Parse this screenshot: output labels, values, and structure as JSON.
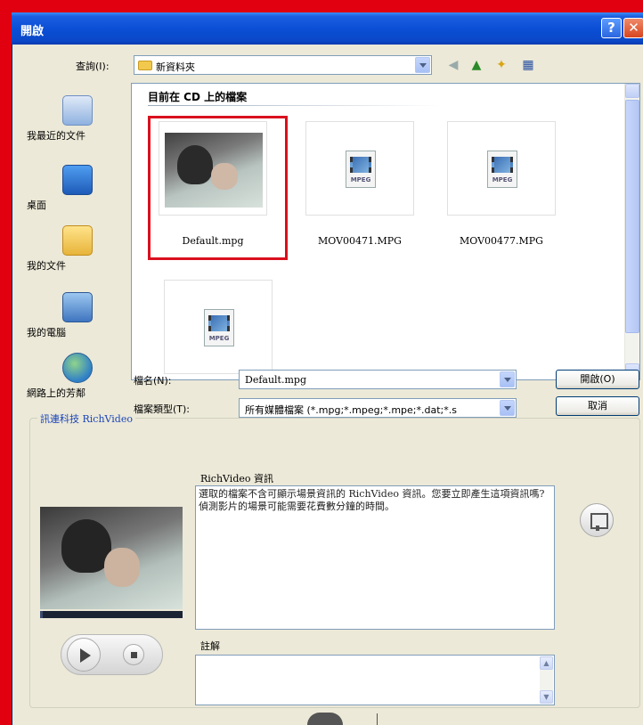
{
  "window": {
    "title": "開啟"
  },
  "lookin": {
    "label": "查詢(I):",
    "value": "新資料夾"
  },
  "toolbar": {
    "back": "◀",
    "up": "▲",
    "new_folder": "✦",
    "views": "▦"
  },
  "places": [
    {
      "label": "我最近的文件"
    },
    {
      "label": "桌面"
    },
    {
      "label": "我的文件"
    },
    {
      "label": "我的電腦"
    },
    {
      "label": "網路上的芳鄰"
    }
  ],
  "filelist": {
    "section_header": "目前在 CD 上的檔案",
    "files": [
      {
        "name": "Default.mpg",
        "kind": "video-thumbnail"
      },
      {
        "name": "MOV00471.MPG",
        "kind": "mpeg-icon"
      },
      {
        "name": "MOV00477.MPG",
        "kind": "mpeg-icon"
      },
      {
        "name": "",
        "kind": "mpeg-icon"
      }
    ],
    "mpeg_tag": "MPEG"
  },
  "filename": {
    "label": "檔名(N):",
    "value": "Default.mpg"
  },
  "filetype": {
    "label": "檔案類型(T):",
    "value": "所有媒體檔案 (*.mpg;*.mpeg;*.mpe;*.dat;*.s"
  },
  "buttons": {
    "open": "開啟(O)",
    "cancel": "取消"
  },
  "richvideo": {
    "group_title": "訊連科技 RichVideo",
    "info_label": "RichVideo 資訊",
    "info_text": "選取的檔案不含可顯示場景資訊的 RichVideo 資訊。您要立即產生這項資訊嗎?偵測影片的場景可能需要花費數分鐘的時間。",
    "notes_label": "註解",
    "notes_text": "",
    "progress": 0.02
  },
  "colors": {
    "frame_red": "#e00010",
    "titlebar_blue": "#0b4fd6",
    "dialog_bg": "#ece9d8",
    "highlight_red": "#d9101e",
    "group_title_blue": "#1a44b8"
  }
}
